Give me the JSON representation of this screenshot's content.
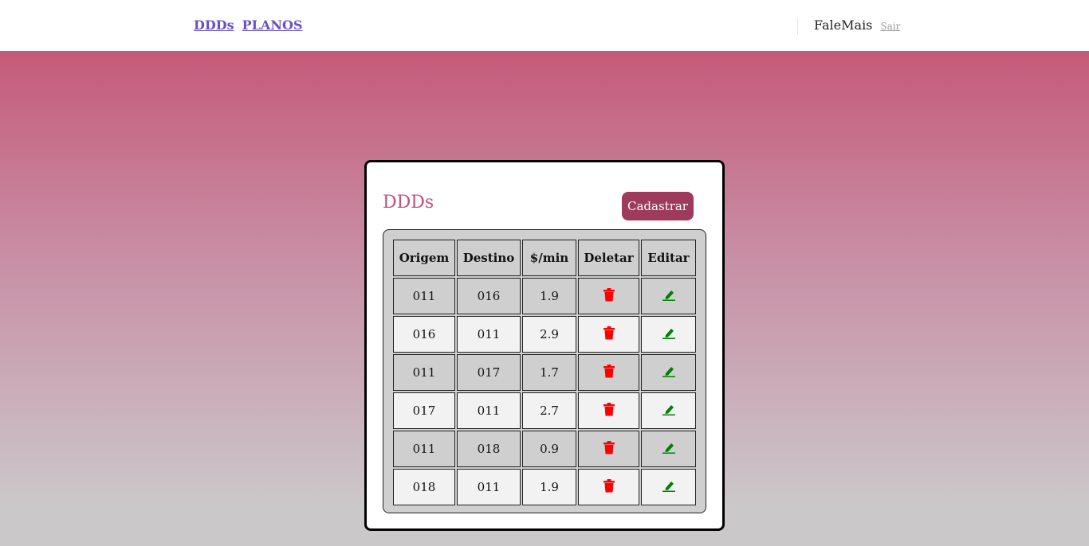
{
  "nav": {
    "links": [
      "DDDs",
      "PLANOS"
    ]
  },
  "user": {
    "brand": "FaleMais",
    "logout": "Sair"
  },
  "card": {
    "title": "DDDs",
    "add_button": "Cadastrar",
    "columns": [
      "Origem",
      "Destino",
      "$/min",
      "Deletar",
      "Editar"
    ],
    "rows": [
      {
        "origem": "011",
        "destino": "016",
        "preco": "1.9"
      },
      {
        "origem": "016",
        "destino": "011",
        "preco": "2.9"
      },
      {
        "origem": "011",
        "destino": "017",
        "preco": "1.7"
      },
      {
        "origem": "017",
        "destino": "011",
        "preco": "2.7"
      },
      {
        "origem": "011",
        "destino": "018",
        "preco": "0.9"
      },
      {
        "origem": "018",
        "destino": "011",
        "preco": "1.9"
      }
    ],
    "delete_icon": "trash-icon",
    "edit_icon": "pencil-icon",
    "delete_color": "#ff0000",
    "edit_color": "#008000"
  }
}
